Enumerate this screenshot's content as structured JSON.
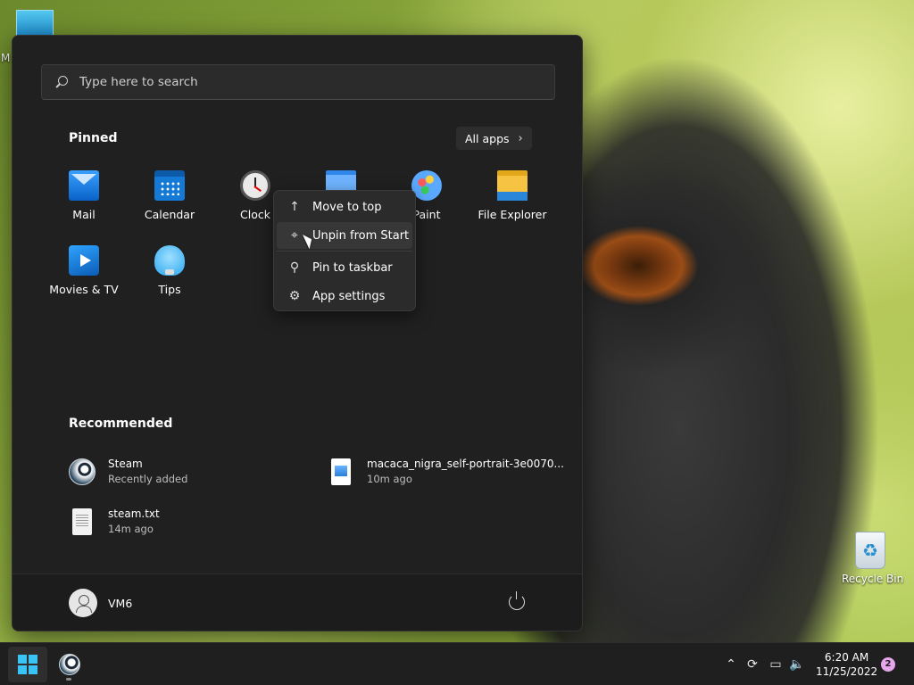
{
  "desktop": {
    "partial_label": "M",
    "recycle_bin_label": "Recycle Bin"
  },
  "start_menu": {
    "search_placeholder": "Type here to search",
    "pinned_title": "Pinned",
    "all_apps_label": "All apps",
    "pinned_apps": [
      {
        "label": "Mail",
        "icon": "mail-icon"
      },
      {
        "label": "Calendar",
        "icon": "calendar-icon"
      },
      {
        "label": "Clock",
        "icon": "clock-icon"
      },
      {
        "label": "",
        "icon": "notepad-icon"
      },
      {
        "label": "Paint",
        "icon": "paint-icon"
      },
      {
        "label": "File Explorer",
        "icon": "folder-icon"
      },
      {
        "label": "Movies & TV",
        "icon": "movies-icon"
      },
      {
        "label": "Tips",
        "icon": "tips-icon"
      }
    ],
    "recommended_title": "Recommended",
    "recommended": [
      {
        "name": "Steam",
        "detail": "Recently added",
        "icon": "steam-icon"
      },
      {
        "name": "macaca_nigra_self-portrait-3e0070...",
        "detail": "10m ago",
        "icon": "image-file-icon"
      },
      {
        "name": "steam.txt",
        "detail": "14m ago",
        "icon": "text-file-icon"
      }
    ],
    "user_name": "VM6"
  },
  "context_menu": {
    "items": [
      {
        "label": "Move to top",
        "icon": "arrow-up-icon"
      },
      {
        "label": "Unpin from Start",
        "icon": "unpin-icon"
      },
      {
        "label": "Pin to taskbar",
        "icon": "pin-icon"
      },
      {
        "label": "App settings",
        "icon": "gear-icon"
      }
    ]
  },
  "taskbar": {
    "time": "6:20 AM",
    "date": "11/25/2022",
    "notification_count": "2"
  },
  "colors": {
    "accent": "#3ac4f5",
    "start_bg": "#202020",
    "taskbar_bg": "#1f1f1f",
    "badge": "#e7a6ec"
  }
}
